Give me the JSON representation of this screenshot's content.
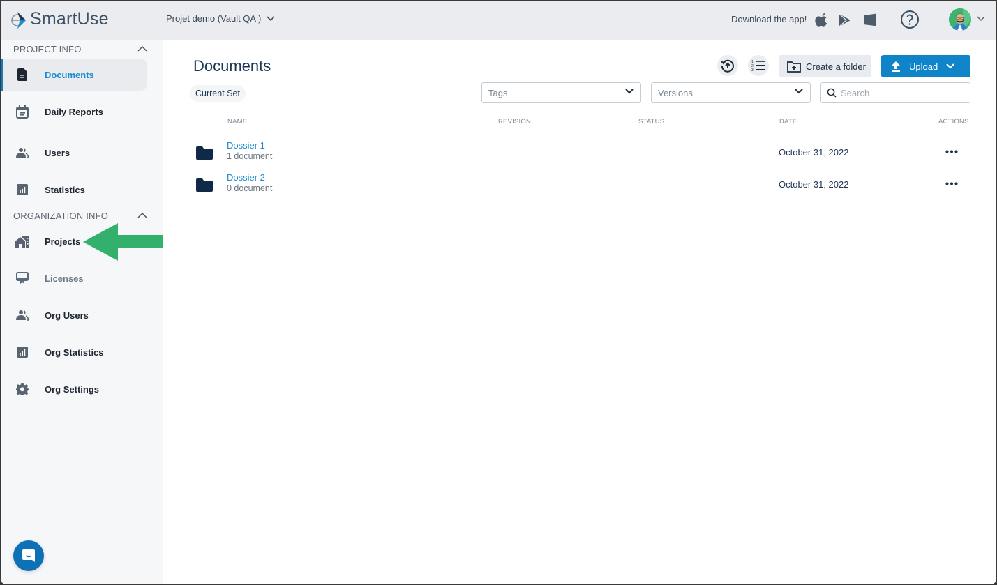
{
  "header": {
    "logo_text": "SmartUse",
    "project_name": "Projet demo (Vault QA )",
    "download_label": "Download the app!",
    "store_icons": [
      "apple-icon",
      "google-play-icon",
      "windows-icon"
    ],
    "help_icon": "help-circle-icon",
    "avatar_icon": "user-avatar"
  },
  "sidebar": {
    "project_section": {
      "title": "PROJECT INFO",
      "items": [
        {
          "label": "Documents",
          "icon": "document-icon",
          "active": true
        },
        {
          "label": "Daily Reports",
          "icon": "calendar-icon"
        },
        {
          "label": "Users",
          "icon": "users-icon"
        },
        {
          "label": "Statistics",
          "icon": "statistics-icon"
        }
      ]
    },
    "org_section": {
      "title": "ORGANIZATION INFO",
      "items": [
        {
          "label": "Projects",
          "icon": "projects-icon"
        },
        {
          "label": "Licenses",
          "icon": "license-icon",
          "muted": true
        },
        {
          "label": "Org Users",
          "icon": "users-icon"
        },
        {
          "label": "Org Statistics",
          "icon": "statistics-icon"
        },
        {
          "label": "Org Settings",
          "icon": "gear-icon"
        }
      ]
    },
    "annotation": "green-arrow-pointing-to-projects",
    "chat_icon": "chat-icon"
  },
  "main": {
    "title": "Documents",
    "current_set_label": "Current Set",
    "toolbar": {
      "history_icon": "history-upload-icon",
      "numbered_list_icon": "numbered-list-icon",
      "create_folder_label": "Create a folder",
      "upload_label": "Upload"
    },
    "filters": {
      "tags_placeholder": "Tags",
      "versions_placeholder": "Versions",
      "search_placeholder": "Search"
    },
    "table": {
      "columns": [
        "NAME",
        "REVISION",
        "STATUS",
        "DATE",
        "ACTIONS"
      ],
      "rows": [
        {
          "name": "Dossier 1",
          "count": "1 document",
          "revision": "",
          "status": "",
          "date": "October 31, 2022"
        },
        {
          "name": "Dossier 2",
          "count": "0 document",
          "revision": "",
          "status": "",
          "date": "October 31, 2022"
        }
      ]
    }
  },
  "colors": {
    "accent": "#0f84c9",
    "link": "#1a8bd0",
    "navy": "#1c3553",
    "arrow": "#34b06d",
    "topbar": "#ebecef",
    "sidebar": "#f6f7f9"
  }
}
